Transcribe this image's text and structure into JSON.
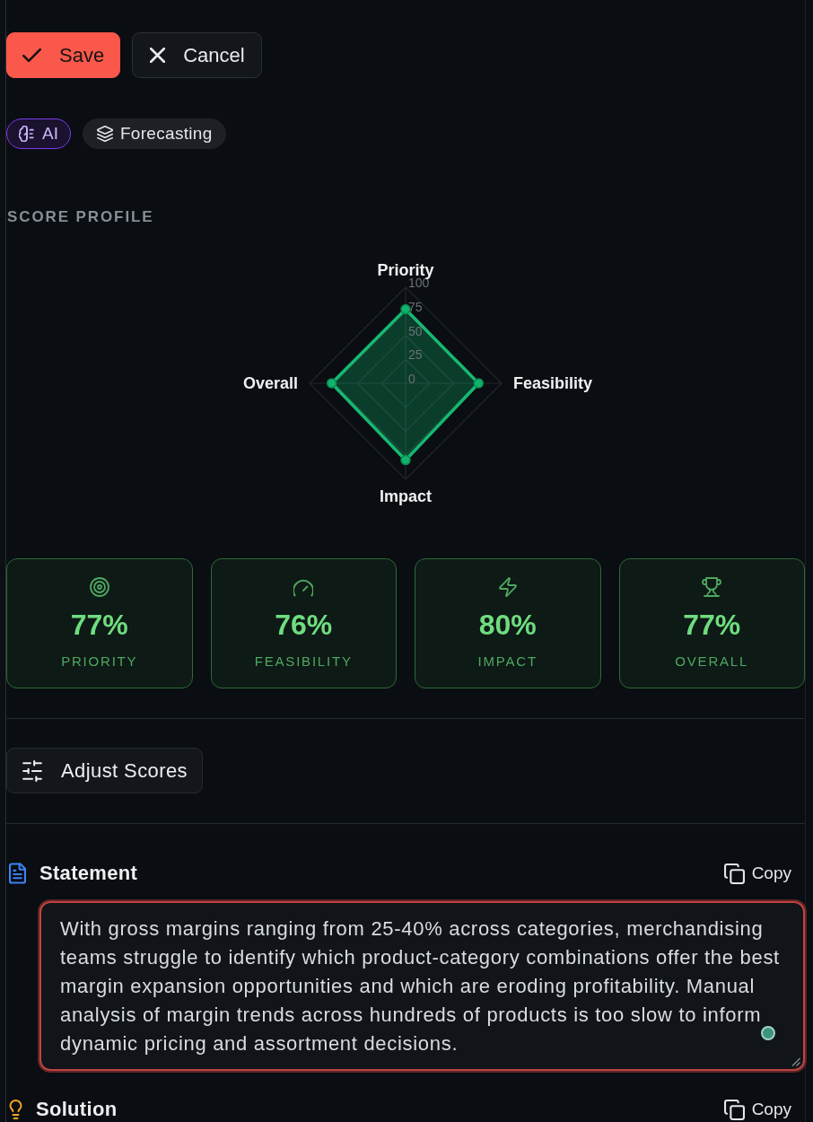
{
  "actions": [
    {
      "kind": "primary",
      "label": "Save"
    },
    {
      "kind": "secondary",
      "label": "Cancel"
    }
  ],
  "tags": [
    {
      "kind": "ai",
      "label": "AI"
    },
    {
      "kind": "topic",
      "label": "Forecasting"
    }
  ],
  "score_profile": {
    "title": "SCORE PROFILE",
    "chart_data": {
      "type": "radar",
      "categories": [
        "Priority",
        "Feasibility",
        "Impact",
        "Overall"
      ],
      "values": [
        77,
        76,
        80,
        77
      ],
      "ylim": [
        0,
        100
      ],
      "yticks": [
        0,
        25,
        50,
        75,
        100
      ]
    }
  },
  "score_cards": [
    {
      "value": "77%",
      "label": "PRIORITY"
    },
    {
      "value": "76%",
      "label": "FEASIBILITY"
    },
    {
      "value": "80%",
      "label": "IMPACT"
    },
    {
      "value": "77%",
      "label": "OVERALL"
    }
  ],
  "adjust_button": {
    "label": "Adjust Scores"
  },
  "statement": {
    "title": "Statement",
    "copy_label": "Copy",
    "text": "With gross margins ranging from 25-40% across categories, merchandising teams struggle to identify which product-category combinations offer the best margin expansion opportunities and which are eroding profitability. Manual analysis of margin trends across hundreds of products is too slow to inform dynamic pricing and assortment decisions.",
    "focused": true
  },
  "solution": {
    "title": "Solution",
    "copy_label": "Copy"
  }
}
